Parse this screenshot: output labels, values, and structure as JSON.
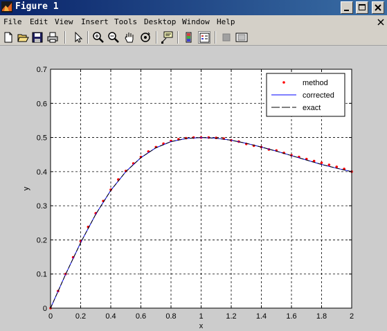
{
  "window": {
    "title": "Figure 1"
  },
  "menu": [
    "File",
    "Edit",
    "View",
    "Insert",
    "Tools",
    "Desktop",
    "Window",
    "Help"
  ],
  "toolbar": {
    "icons": [
      "new-icon",
      "open-icon",
      "save-icon",
      "print-icon",
      "pointer-icon",
      "zoom-in-icon",
      "zoom-out-icon",
      "pan-icon",
      "rotate-icon",
      "data-cursor-icon",
      "colorbar-icon",
      "legend-icon",
      "hide-plot-tools-icon",
      "show-plot-tools-icon"
    ]
  },
  "colors": {
    "titlebar": "#0a246a",
    "method": "#ff0000",
    "corrected": "#0000ff",
    "exact": "#000000"
  },
  "chart_data": {
    "type": "line",
    "xlabel": "x",
    "ylabel": "y",
    "xlim": [
      0,
      2
    ],
    "ylim": [
      0,
      0.7
    ],
    "xticks": [
      0,
      0.2,
      0.4,
      0.6,
      0.8,
      1,
      1.2,
      1.4,
      1.6,
      1.8,
      2
    ],
    "yticks": [
      0,
      0.1,
      0.2,
      0.3,
      0.4,
      0.5,
      0.6,
      0.7
    ],
    "grid": true,
    "legend": "top-right",
    "series": [
      {
        "name": "method",
        "style": "dots",
        "x": [
          0,
          0.05,
          0.1,
          0.15,
          0.2,
          0.25,
          0.3,
          0.35,
          0.4,
          0.45,
          0.5,
          0.55,
          0.6,
          0.65,
          0.7,
          0.75,
          0.8,
          0.85,
          0.9,
          0.95,
          1,
          1.05,
          1.1,
          1.15,
          1.2,
          1.25,
          1.3,
          1.35,
          1.4,
          1.45,
          1.5,
          1.55,
          1.6,
          1.65,
          1.7,
          1.75,
          1.8,
          1.85,
          1.9,
          1.95,
          2
        ],
        "y": [
          0,
          0.05,
          0.1,
          0.149,
          0.196,
          0.238,
          0.278,
          0.314,
          0.347,
          0.377,
          0.402,
          0.424,
          0.443,
          0.459,
          0.472,
          0.482,
          0.49,
          0.495,
          0.498,
          0.5,
          0.5,
          0.5,
          0.499,
          0.497,
          0.492,
          0.488,
          0.481,
          0.476,
          0.472,
          0.465,
          0.462,
          0.455,
          0.448,
          0.443,
          0.437,
          0.431,
          0.426,
          0.42,
          0.414,
          0.408,
          0.4
        ]
      },
      {
        "name": "corrected",
        "style": "solid",
        "x": [
          0,
          0.1,
          0.2,
          0.3,
          0.4,
          0.5,
          0.6,
          0.7,
          0.8,
          0.9,
          1,
          1.1,
          1.2,
          1.3,
          1.4,
          1.5,
          1.6,
          1.7,
          1.8,
          1.9,
          2
        ],
        "y": [
          0,
          0.099,
          0.192,
          0.275,
          0.345,
          0.4,
          0.441,
          0.47,
          0.488,
          0.497,
          0.5,
          0.498,
          0.492,
          0.483,
          0.472,
          0.46,
          0.447,
          0.434,
          0.421,
          0.41,
          0.4
        ]
      },
      {
        "name": "exact",
        "style": "dashed",
        "x": [
          0,
          0.1,
          0.2,
          0.3,
          0.4,
          0.5,
          0.6,
          0.7,
          0.8,
          0.9,
          1,
          1.1,
          1.2,
          1.3,
          1.4,
          1.5,
          1.6,
          1.7,
          1.8,
          1.9,
          2
        ],
        "y": [
          0,
          0.099,
          0.192,
          0.275,
          0.345,
          0.4,
          0.441,
          0.47,
          0.488,
          0.497,
          0.5,
          0.498,
          0.492,
          0.483,
          0.472,
          0.46,
          0.447,
          0.434,
          0.421,
          0.41,
          0.4
        ]
      }
    ]
  }
}
